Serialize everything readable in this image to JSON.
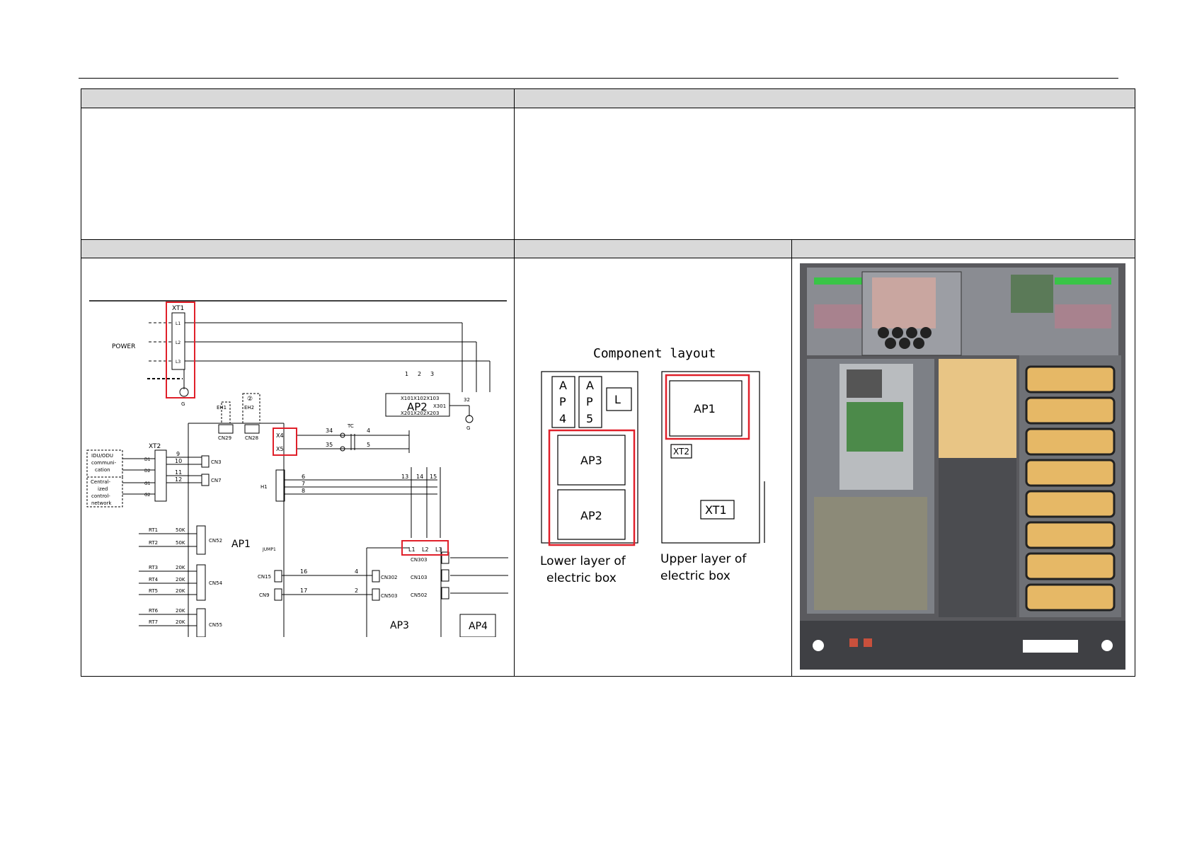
{
  "wiring": {
    "labels": {
      "xt1": "XT1",
      "l1": "L1",
      "l2": "L2",
      "l3": "L3",
      "power": "POWER",
      "g": "G",
      "eh1": "EH1",
      "eh2": "EH2",
      "circ2": "②",
      "cn29": "CN29",
      "cn28": "CN28",
      "x4": "X4",
      "x5": "X5",
      "tc": "TC",
      "w34": "34",
      "w35": "35",
      "w4": "4",
      "w5": "5",
      "w1": "1",
      "w2": "2",
      "w3": "3",
      "ap2": "AP2",
      "x101": "X101X102X103",
      "x201": "X201X202X203",
      "x301": "X301",
      "w32": "32",
      "g2": "G",
      "xt2": "XT2",
      "idu1": "IDU/ODU",
      "idu2": "communi-",
      "idu3": "cation",
      "cen1": "Central-",
      "cen2": "ized",
      "cen3": "control-",
      "cen4": "network",
      "d1": "D1",
      "d2": "D2",
      "g1": "G1",
      "g2t": "G2",
      "w9": "9",
      "w10": "10",
      "w11": "11",
      "w12": "12",
      "cn3": "CN3",
      "cn7": "CN7",
      "w13": "13",
      "w14": "14",
      "w15": "15",
      "h1": "H1",
      "w6": "6",
      "w7": "7",
      "w8": "8",
      "rt1": "RT1",
      "rt2": "RT2",
      "rt3": "RT3",
      "rt4": "RT4",
      "rt5": "RT5",
      "rt6": "RT6",
      "rt7": "RT7",
      "k50a": "50K",
      "k50b": "50K",
      "k20a": "20K",
      "k20b": "20K",
      "k20c": "20K",
      "k20d": "20K",
      "k20e": "20K",
      "cn52": "CN52",
      "cn54": "CN54",
      "cn55": "CN55",
      "ap1": "AP1",
      "jump1": "JUMP1",
      "bl1": "L1",
      "bl2": "L2",
      "bl3": "L3",
      "cn303": "CN303",
      "cn103": "CN103",
      "cn502": "CN502",
      "cn15": "CN15",
      "cn9": "CN9",
      "w16": "16",
      "w17": "17",
      "w4b": "4",
      "w2b": "2",
      "cn302": "CN302",
      "cn503": "CN503",
      "ap3": "AP3",
      "ap4": "AP4"
    }
  },
  "layout": {
    "title": "Component layout",
    "ap4_a": "A",
    "ap4_p": "P",
    "ap4_4": "4",
    "ap5_a": "A",
    "ap5_p": "P",
    "ap5_5": "5",
    "l": "L",
    "ap3": "AP3",
    "ap2": "AP2",
    "ap1": "AP1",
    "xt2": "XT2",
    "xt1": "XT1",
    "lower1": "Lower layer of",
    "lower2": "electric box",
    "upper1": "Upper layer of",
    "upper2": "electric box"
  },
  "colors": {
    "highlight": "#e0202a",
    "header": "#d9d9d9"
  }
}
